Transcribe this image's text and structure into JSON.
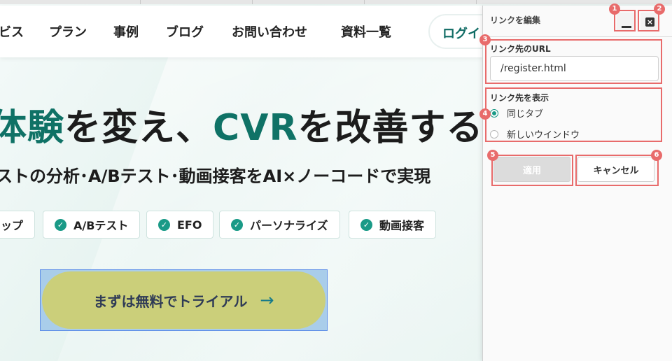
{
  "site": {
    "nav": [
      "ビス",
      "プラン",
      "事例",
      "ブログ",
      "お問い合わせ",
      "資料一覧"
    ],
    "login_label": "ログイ",
    "headline": {
      "g1": "体験",
      "t1": "を変え、",
      "g2": "CVR",
      "t2": "を改善する"
    },
    "subline": "ストの分析･A/Bテスト･動画接客をAI×ノーコードで実現",
    "features": [
      "ップ",
      "A/Bテスト",
      "EFO",
      "パーソナライズ",
      "動画接客"
    ],
    "cta_label": "まずは無料でトライアル",
    "cta_arrow": "→",
    "check_glyph": "✓"
  },
  "panel": {
    "title": "リンクを編集",
    "url_label": "リンク先のURL",
    "url_value": "/register.html",
    "display_label": "リンク先を表示",
    "radio_options": [
      "同じタブ",
      "新しいウインドウ"
    ],
    "selected_option": "同じタブ",
    "apply_label": "適用",
    "cancel_label": "キャンセル",
    "close_glyph": "×"
  },
  "annotations": [
    "1",
    "2",
    "3",
    "4",
    "5",
    "6"
  ],
  "colors": {
    "accent": "#0f7266",
    "highlight": "#e86b6b",
    "cta": "#cbcf7a",
    "check": "#1a9a87"
  },
  "icons": [
    "check-icon",
    "arrow-right-icon",
    "minimize-icon",
    "close-icon",
    "radio-icon"
  ]
}
